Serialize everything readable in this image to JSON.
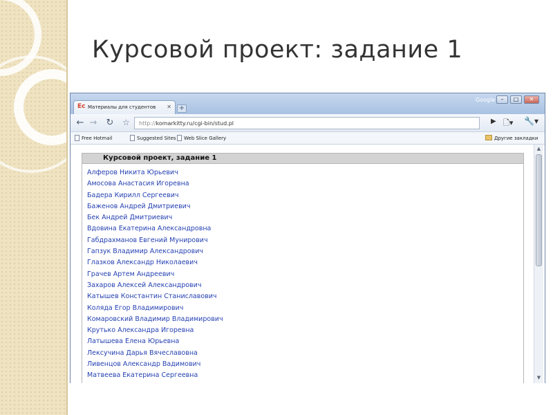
{
  "slide": {
    "title": "Курсовой проект: задание 1"
  },
  "browser": {
    "tab_title": "Материалы для студентов",
    "tab_favicon": "Ес",
    "brand": "Google",
    "address": {
      "scheme": "http://",
      "path": "komarkitty.ru/cgi-bin/stud.pl"
    },
    "bookmarks": [
      {
        "label": "Free Hotmail"
      },
      {
        "label": "Suggested Sites"
      },
      {
        "label": "Web Slice Gallery"
      }
    ],
    "other_bookmarks": "Другие закладки",
    "icons": {
      "back": "arrow-left",
      "forward": "arrow-right",
      "reload": "reload",
      "star": "star",
      "play": "play",
      "page": "page-menu",
      "tools": "wrench"
    }
  },
  "page": {
    "header": "Курсовой проект, задание 1",
    "students": [
      "Алферов Никита Юрьевич",
      "Амосова Анастасия Игоревна",
      "Бадера Кирилл Сергеевич",
      "Баженов Андрей Дмитриевич",
      "Бек Андрей Дмитриевич",
      "Вдовина Екатерина Александровна",
      "Габдрахманов Евгений Мунирович",
      "Гапзук Владимир Александрович",
      "Глазков Александр Николаевич",
      "Грачев Артем Андреевич",
      "Захаров Алексей Александрович",
      "Катышев Константин Станиславович",
      "Коляда Егор Владимирович",
      "Комаровский Владимир Владимирович",
      "Крутько Александра Игоревна",
      "Латышева Елена Юрьевна",
      "Лексучина Дарья Вячеславовна",
      "Ливенцов Александр Вадимович",
      "Матвеева Екатерина Сергеевна"
    ]
  },
  "colors": {
    "link": "#2541b2",
    "header_bg": "#d3d3d3",
    "chrome_frame": "#b9cde8",
    "slide_accent": "#efe3c2"
  }
}
